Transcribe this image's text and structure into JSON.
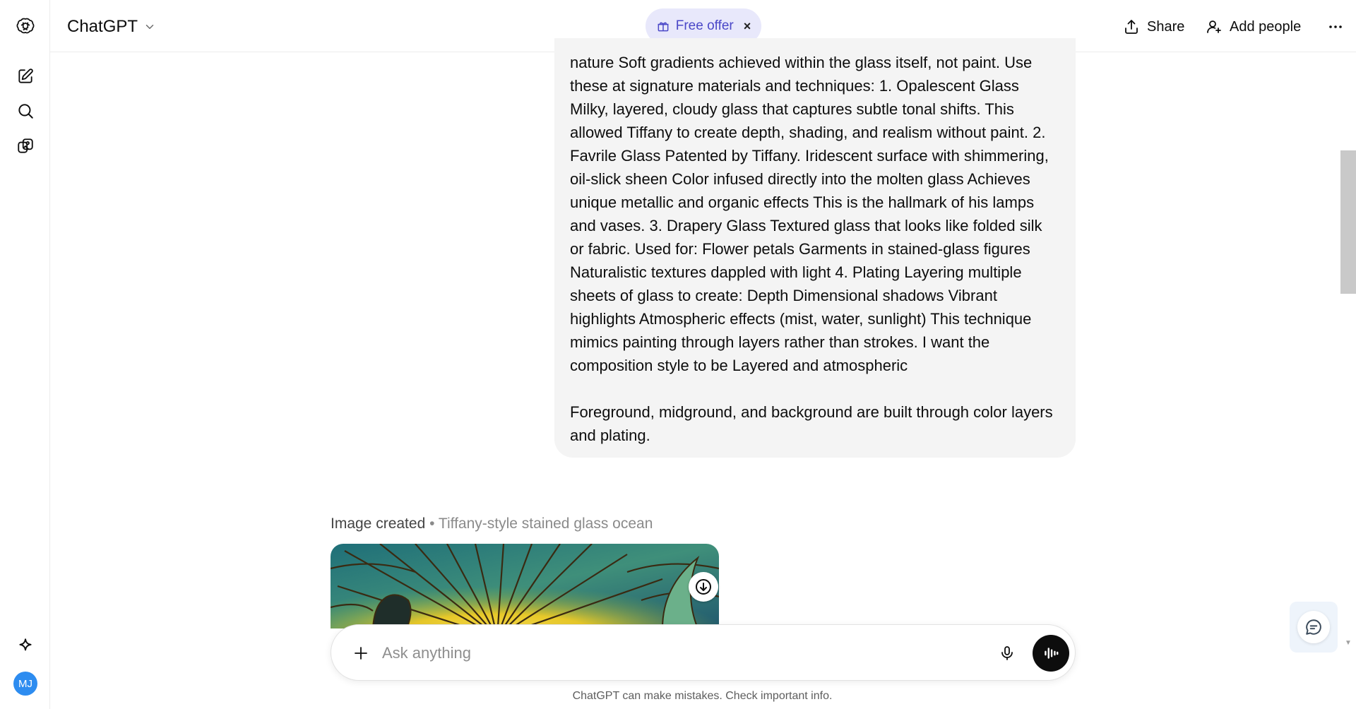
{
  "rail": {
    "new_chat_icon": "new-chat-icon",
    "search_icon": "search-icon",
    "library_icon": "images-library-icon",
    "sparkle_icon": "sparkle-icon",
    "avatar_initials": "MJ"
  },
  "header": {
    "model_label": "ChatGPT",
    "free_offer_label": "Free offer",
    "free_offer_close": "×",
    "share_label": "Share",
    "add_people_label": "Add people"
  },
  "message": {
    "paragraph_1": "nature  Soft gradients achieved within the glass itself, not paint. Use these at signature materials and techniques: 1. Opalescent Glass  Milky, layered, cloudy glass that captures subtle tonal shifts. This allowed Tiffany to create depth, shading, and realism without paint.  2. Favrile Glass  Patented by Tiffany.  Iridescent surface with shimmering, oil-slick sheen  Color infused directly into the molten glass  Achieves unique metallic and organic effects  This is the hallmark of his lamps and vases. 3. Drapery Glass  Textured glass that looks like folded silk or fabric. Used for:  Flower petals  Garments in stained-glass figures  Naturalistic textures dappled with light  4. Plating  Layering multiple sheets of glass to create:  Depth  Dimensional shadows  Vibrant highlights Atmospheric effects (mist, water, sunlight)  This technique mimics painting through layers rather than strokes. I want the composition style to be Layered and atmospheric",
    "paragraph_2": "Foreground, midground, and background are built through color layers and plating."
  },
  "image_result": {
    "caption_lead": "Image created",
    "caption_sub": "• Tiffany-style stained glass ocean"
  },
  "composer": {
    "placeholder": "Ask anything",
    "value": ""
  },
  "footer": {
    "disclaimer": "ChatGPT can make mistakes. Check important info."
  },
  "colors": {
    "accent_offer": "#4b48c8",
    "offer_bg": "#e8e8fb",
    "bubble_bg": "#f4f4f4",
    "avatar_bg": "#2d8cf0"
  }
}
